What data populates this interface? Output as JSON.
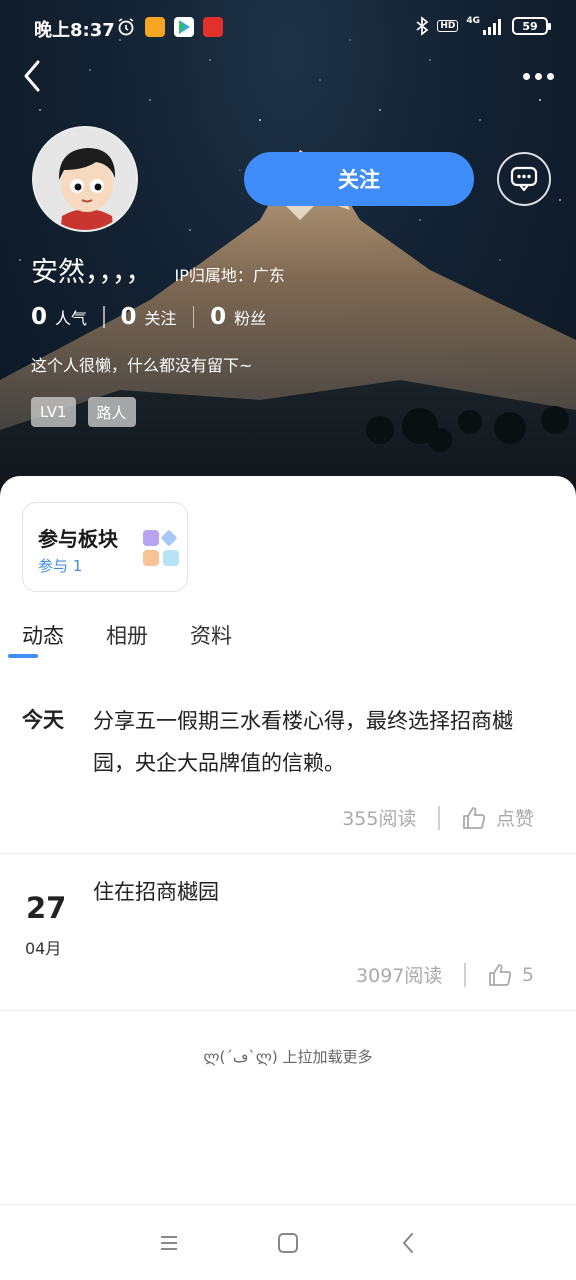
{
  "status_bar": {
    "time": "晚上8:37",
    "hd": "HD",
    "signal": "4G",
    "battery": "59",
    "icons": [
      "alarm-icon",
      "message-app-icon",
      "play-store-icon",
      "shopping-app-icon",
      "bluetooth-icon"
    ]
  },
  "header": {
    "back_icon": "back-arrow-icon",
    "more_icon": "more-dots-icon"
  },
  "profile": {
    "name": "安然，，，，",
    "ip_location": "IP归属地：广东",
    "follow_label": "关注",
    "message_icon": "chat-bubble-icon",
    "stats": [
      {
        "value": "0",
        "label": "人气"
      },
      {
        "value": "0",
        "label": "关注"
      },
      {
        "value": "0",
        "label": "粉丝"
      }
    ],
    "bio": "这个人很懒，什么都没有留下~",
    "tags": [
      "LV1",
      "路人"
    ]
  },
  "board": {
    "title": "参与板块",
    "subtitle": "参与 1"
  },
  "tabs": [
    {
      "label": "动态",
      "active": true
    },
    {
      "label": "相册",
      "active": false
    },
    {
      "label": "资料",
      "active": false
    }
  ],
  "posts": [
    {
      "date_label": "今天",
      "text": "分享五一假期三水看楼心得，最终选择招商樾园，央企大品牌值的信赖。",
      "reads": "355阅读",
      "like": "点赞"
    },
    {
      "day": "27",
      "month": "04月",
      "text": "住在招商樾园",
      "reads": "3097阅读",
      "like": "5"
    }
  ],
  "load_more": "ლ(´ڡ`ლ) 上拉加载更多",
  "nav": [
    "menu-icon",
    "home-icon",
    "back-icon"
  ],
  "colors": {
    "accent": "#3f8dfa",
    "sheet": "#ffffff"
  }
}
